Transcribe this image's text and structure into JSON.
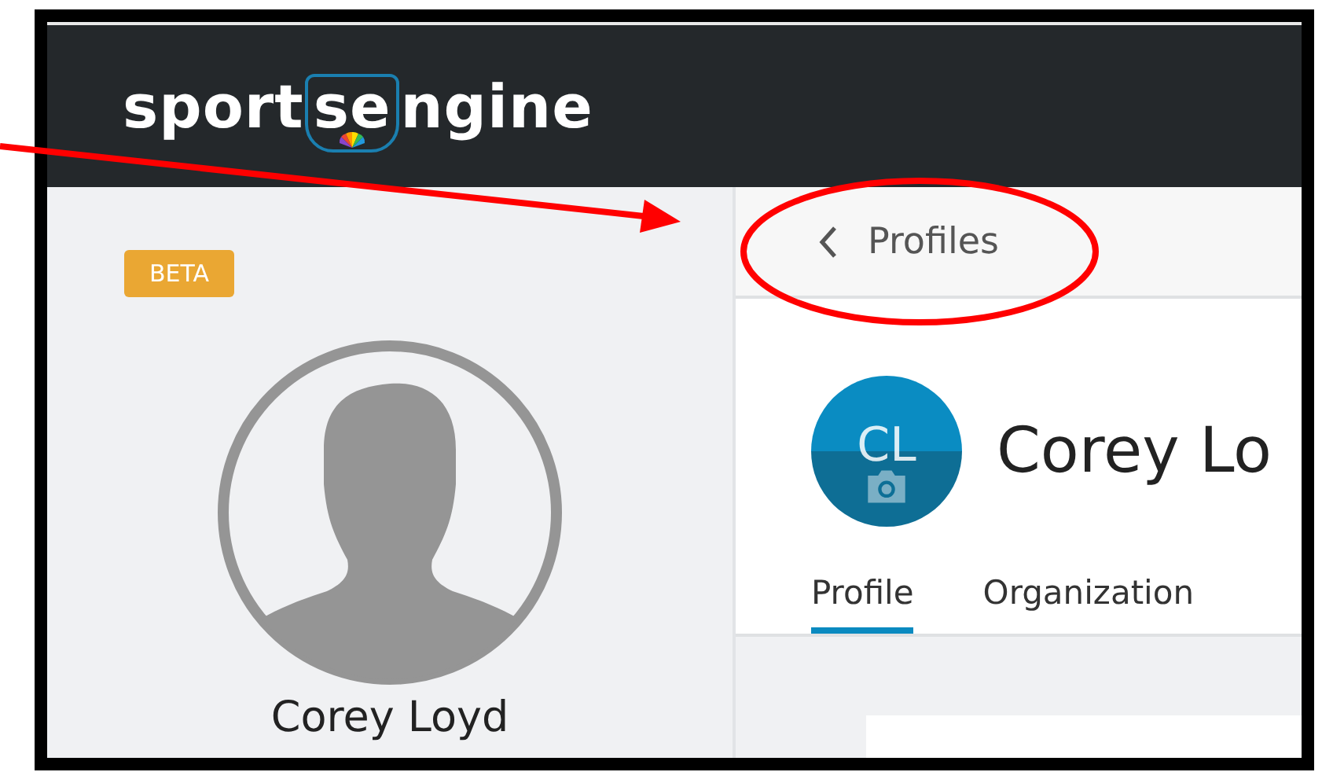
{
  "header": {
    "logo": {
      "parts": [
        "sport",
        "se",
        "ngine"
      ]
    }
  },
  "sidebar": {
    "badge": "BETA",
    "name": "Corey Loyd"
  },
  "breadcrumb": {
    "back_label": "Profiles"
  },
  "profile": {
    "initials": "CL",
    "name": "Corey Lo",
    "tabs": [
      {
        "label": "Profile",
        "selected": true
      },
      {
        "label": "Organization",
        "selected": false
      }
    ]
  }
}
